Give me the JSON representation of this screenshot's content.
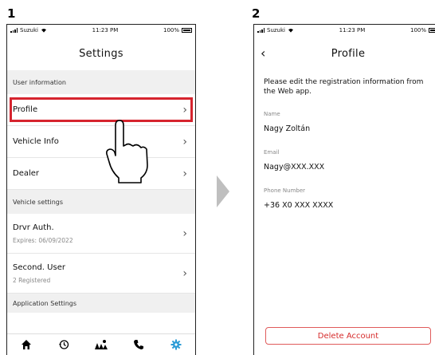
{
  "steps": {
    "one": "1",
    "two": "2"
  },
  "status": {
    "carrier": "Suzuki",
    "time": "11:23 PM",
    "battery": "100%"
  },
  "settings": {
    "title": "Settings",
    "sections": {
      "user_info": "User information",
      "vehicle_settings": "Vehicle settings",
      "app_settings": "Application Settings"
    },
    "rows": {
      "profile": "Profile",
      "vehicle_info": "Vehicle Info",
      "dealer": "Dealer",
      "drvr_auth": "Drvr Auth.",
      "drvr_auth_sub": "Expires: 06/09/2022",
      "second_user": "Second. User",
      "second_user_sub": "2 Registered"
    },
    "tabs": [
      "home-icon",
      "history-icon",
      "map-icon",
      "phone-icon",
      "gear-icon"
    ],
    "active_tab_color": "#2a9bd6",
    "highlight_color": "#d6242e"
  },
  "profile": {
    "title": "Profile",
    "notice": "Please edit the registration information from the Web app.",
    "name_label": "Name",
    "name_value": "Nagy Zoltán",
    "email_label": "Email",
    "email_value": "Nagy@XXX.XXX",
    "phone_label": "Phone Number",
    "phone_value": "+36 X0 XXX XXXX",
    "delete_label": "Delete Account",
    "delete_color": "#d62b2b"
  }
}
